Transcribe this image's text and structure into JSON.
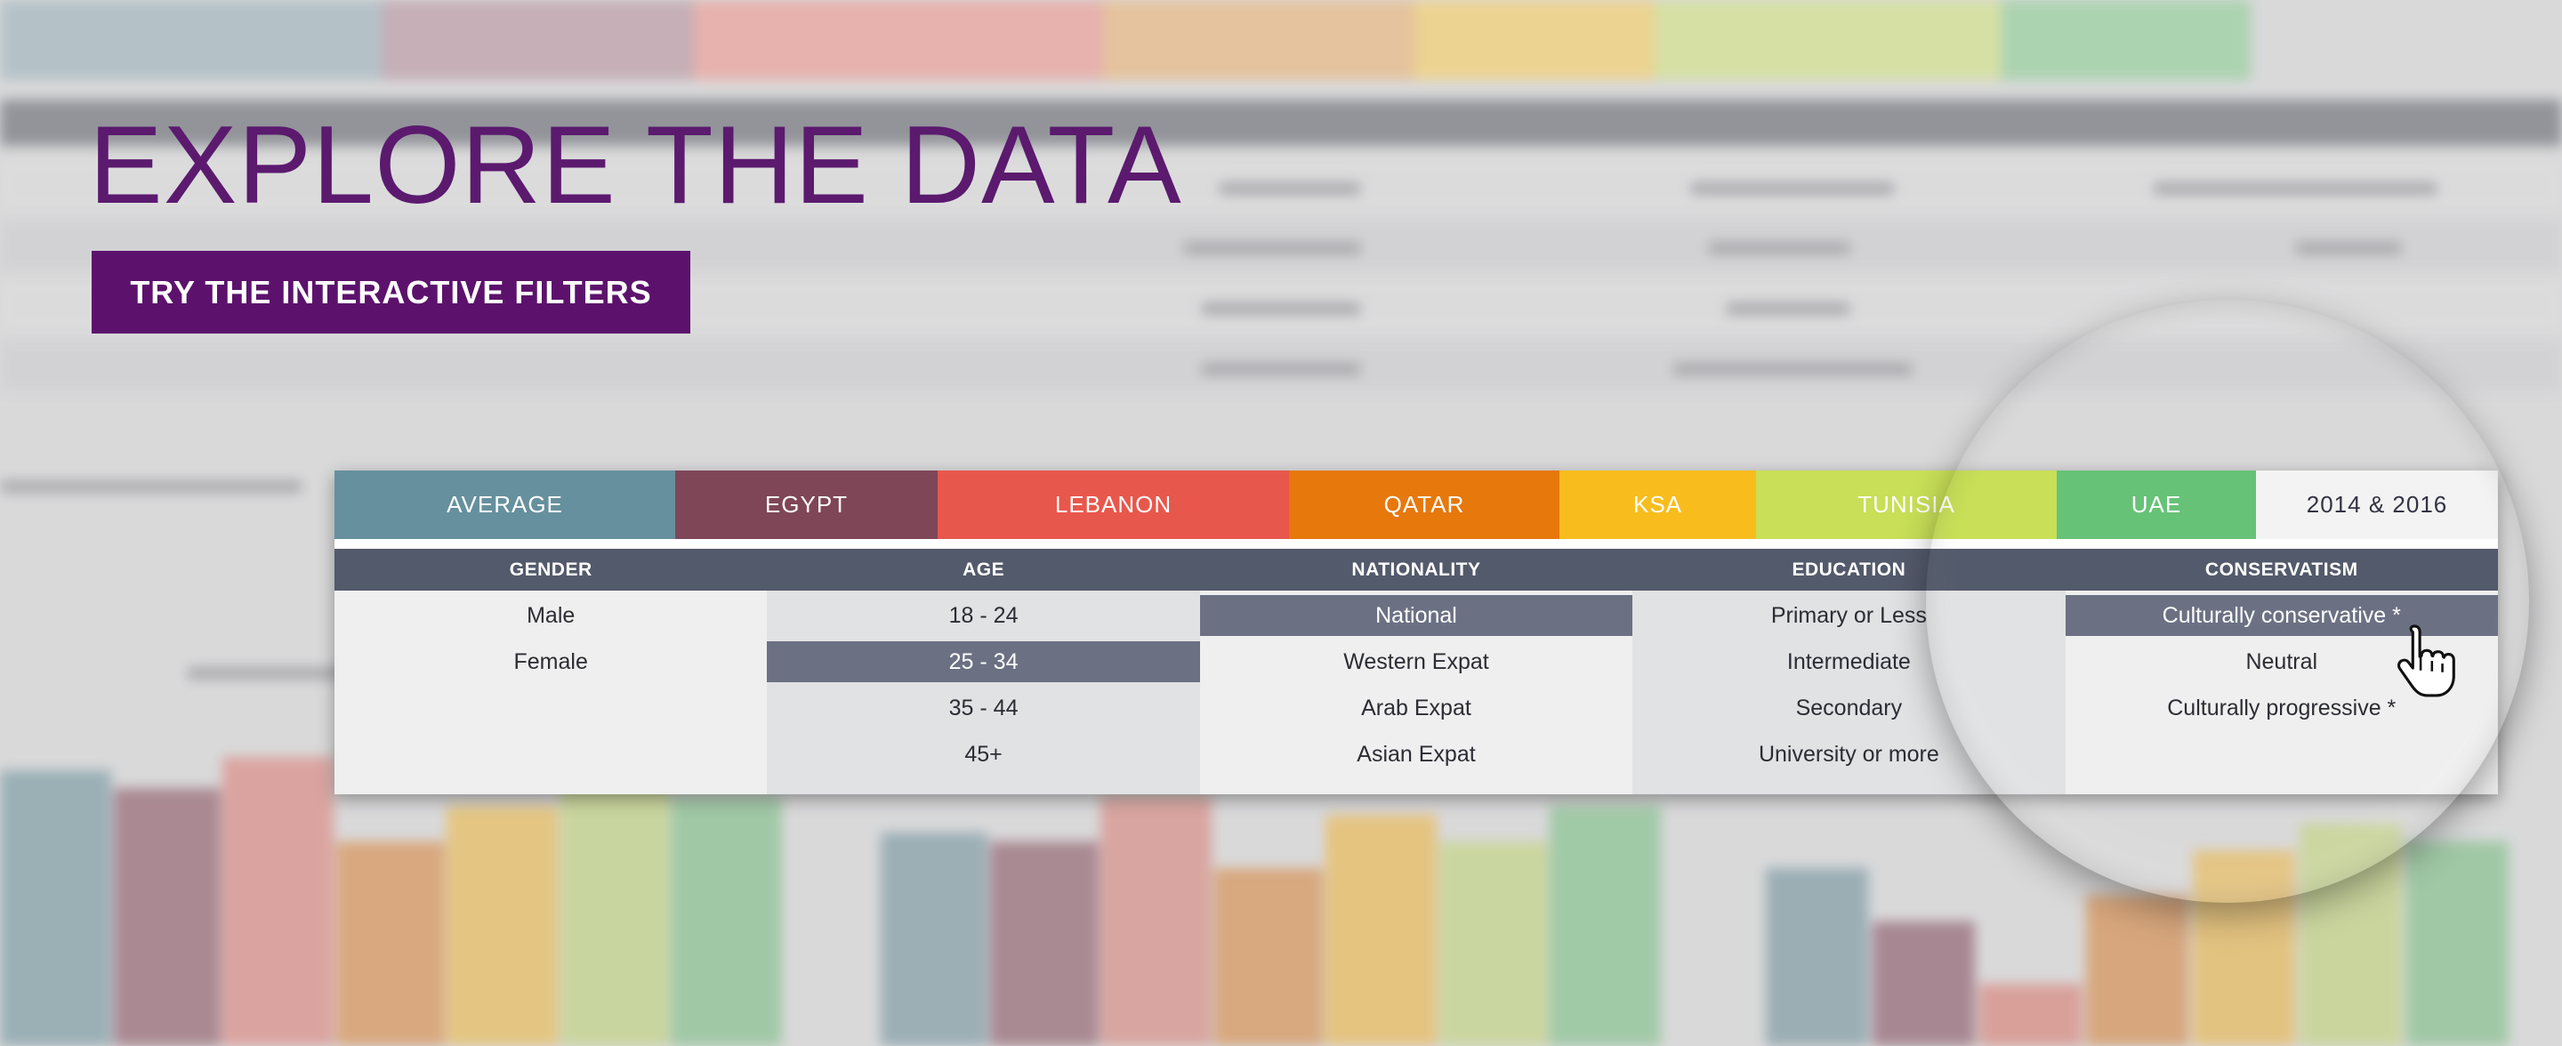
{
  "hero": {
    "title": "EXPLORE THE DATA",
    "cta_label": "TRY THE INTERACTIVE FILTERS"
  },
  "colors": {
    "brand_purple": "#5c126c",
    "header_strip": "#535a6b",
    "selected_option": "#6b7183"
  },
  "tabs": [
    {
      "label": "AVERAGE",
      "color": "#66909d"
    },
    {
      "label": "EGYPT",
      "color": "#7f4657"
    },
    {
      "label": "LEBANON",
      "color": "#e8574b"
    },
    {
      "label": "QATAR",
      "color": "#e6780c"
    },
    {
      "label": "KSA",
      "color": "#f8bd1c"
    },
    {
      "label": "TUNISIA",
      "color": "#c8df57"
    },
    {
      "label": "UAE",
      "color": "#66c277"
    },
    {
      "label": "2014 & 2016",
      "color": "#f3f3f3"
    }
  ],
  "filters": [
    {
      "header": "GENDER",
      "options": [
        "Male",
        "Female"
      ],
      "selected": null
    },
    {
      "header": "AGE",
      "options": [
        "18 - 24",
        "25 - 34",
        "35 - 44",
        "45+"
      ],
      "selected": 1
    },
    {
      "header": "NATIONALITY",
      "options": [
        "National",
        "Western Expat",
        "Arab Expat",
        "Asian Expat"
      ],
      "selected": 0
    },
    {
      "header": "EDUCATION",
      "options": [
        "Primary or Less",
        "Intermediate",
        "Secondary",
        "University or more"
      ],
      "selected": null
    },
    {
      "header": "CONSERVATISM",
      "options": [
        "Culturally conservative *",
        "Neutral",
        "Culturally progressive *"
      ],
      "selected": 0
    }
  ],
  "icons": {
    "cursor": "hand-pointer-icon",
    "lens": "magnifier-lens"
  }
}
